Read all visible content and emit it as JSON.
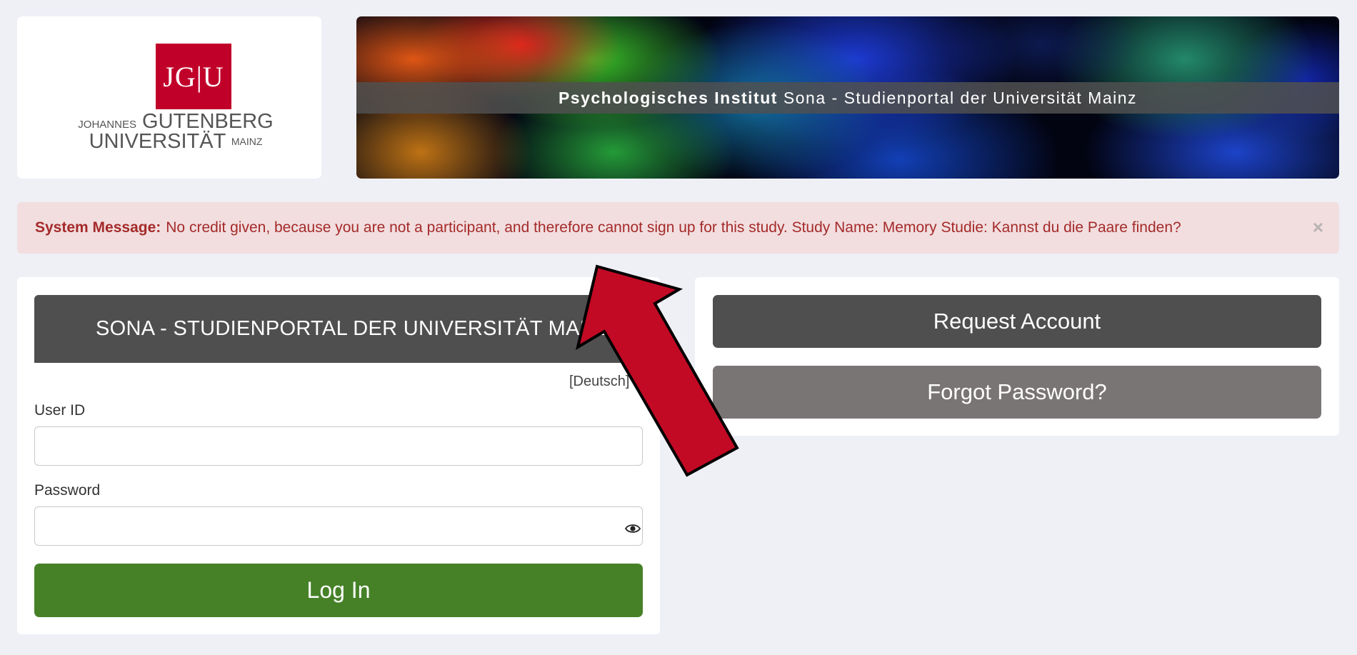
{
  "logo": {
    "mark": "JG|U",
    "line1_small": "JOHANNES",
    "line1_big": "GUTENBERG",
    "line2_big": "UNIVERSITÄT",
    "line2_small": "MAINZ"
  },
  "banner": {
    "title_bold": "Psychologisches Institut",
    "title_rest": "Sona - Studienportal der Universität Mainz"
  },
  "alert": {
    "label": "System Message:",
    "text": "No credit given, because you are not a participant, and therefore cannot sign up for this study. Study Name: Memory Studie: Kannst du die Paare finden?",
    "close": "×"
  },
  "login": {
    "header": "SONA - STUDIENPORTAL DER UNIVERSITÄT MAINZ",
    "language_link": "[Deutsch]",
    "userid_label": "User ID",
    "userid_value": "",
    "password_label": "Password",
    "password_value": "",
    "submit_label": "Log In"
  },
  "actions": {
    "request_account": "Request Account",
    "forgot_password": "Forgot Password?"
  },
  "colors": {
    "background": "#eff0f6",
    "brand_red": "#c1002a",
    "alert_bg": "#f2dedf",
    "alert_text": "#a52a2a",
    "login_green": "#468128",
    "dark_button": "#4f4f4f",
    "grey_button": "#7a7575",
    "arrow": "#c20a25"
  }
}
